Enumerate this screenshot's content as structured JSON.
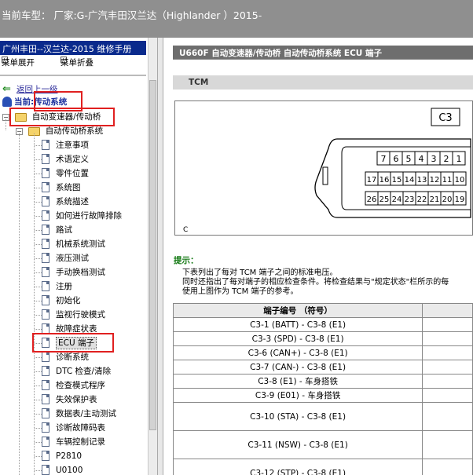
{
  "window": {
    "title": "当前车型： 厂家:G-广汽丰田汉兰达（Highlander ）2015-"
  },
  "sidebar": {
    "manual_title": "广州丰田--汉兰达-2015 维修手册",
    "expand_label": "菜单展开",
    "collapse_label": "菜单折叠",
    "back_label": "返回上一级",
    "current_system": "当前:传动系统",
    "folder": "自动变速器/传动桥",
    "subfolder": "自动传动桥系统",
    "items": [
      "注意事项",
      "术语定义",
      "零件位置",
      "系统图",
      "系统描述",
      "如何进行故障排除",
      "路试",
      "机械系统测试",
      "液压测试",
      "手动换档测试",
      "注册",
      "初始化",
      "监视行驶模式",
      "故障症状表",
      "ECU 端子",
      "诊断系统",
      "DTC 检查/清除",
      "检查模式程序",
      "失效保护表",
      "数据表/主动测试",
      "诊断故障码表",
      "车辆控制记录",
      "P2810",
      "U0100"
    ],
    "selected_index": 14
  },
  "content": {
    "header": "U660F 自动变速器/传动桥  自动传动桥系统  ECU 端子",
    "section": "TCM",
    "diagram": {
      "connector_label": "C3",
      "row1": [
        "7",
        "6",
        "5",
        "4",
        "3",
        "2",
        "1"
      ],
      "row2": [
        "17",
        "16",
        "15",
        "14",
        "13",
        "12",
        "11",
        "10"
      ],
      "row3": [
        "26",
        "25",
        "24",
        "23",
        "22",
        "21",
        "20",
        "19"
      ],
      "corner_label": "C"
    },
    "tip_title": "提示：",
    "tip_lines": [
      "下表列出了每对 TCM 端子之间的标准电压。",
      "同时还指出了每对端子的相应检查条件。将检查结果与\"规定状态\"栏所示的每",
      "使用上图作为 TCM 端子的参考。"
    ],
    "table": {
      "header": "端子编号 （符号）",
      "rows": [
        "C3-1 (BATT) - C3-8 (E1)",
        "C3-3 (SPD) - C3-8 (E1)",
        "C3-6 (CAN+) - C3-8 (E1)",
        "C3-7 (CAN-) - C3-8 (E1)",
        "C3-8 (E1) - 车身搭铁",
        "C3-9 (E01) - 车身搭铁",
        "C3-10 (STA) - C3-8 (E1)",
        "C3-11 (NSW) - C3-8 (E1)",
        "C3-12 (STP) - C3-8 (E1)"
      ]
    }
  },
  "colors": {
    "sidebar_title_bg": "#0a2a8c",
    "highlight_box": "#e02020",
    "tip_green": "#157a15",
    "topbar_bg": "#8f8f8f"
  }
}
